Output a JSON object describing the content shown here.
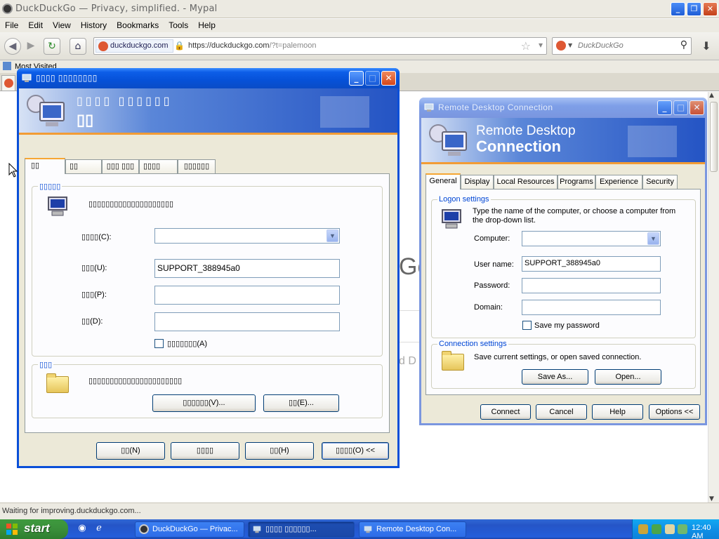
{
  "browser": {
    "title": "DuckDuckGo — Privacy, simplified. - Mypal",
    "menu": [
      "File",
      "Edit",
      "View",
      "History",
      "Bookmarks",
      "Tools",
      "Help"
    ],
    "identity": "duckduckgo.com",
    "url_main": "https://duckduckgo.com",
    "url_tail": "/?t=palemoon",
    "search_placeholder": "DuckDuckGo",
    "bookmark": "Most Visited",
    "status": "Waiting for improving.duckduckgo.com...",
    "page_fragments": {
      "logo": "Go",
      "sub": "d D"
    }
  },
  "garbled_dialog": {
    "title": "▯▯▯▯ ▯▯▯▯▯▯▯▯",
    "banner_line1": "▯▯▯▯ ▯▯▯▯▯▯",
    "banner_line2": "▯▯",
    "tabs": [
      "▯▯",
      "▯▯",
      "▯▯▯ ▯▯▯",
      "▯▯▯▯",
      "▯▯▯▯▯▯"
    ],
    "group1_label": "▯▯▯▯▯",
    "group1_desc": "▯▯▯▯▯▯▯▯▯▯▯▯▯▯▯▯▯▯▯▯",
    "computer_label": "▯▯▯▯(C):",
    "username_label": "▯▯▯(U):",
    "username_value": "SUPPORT_388945a0",
    "password_label": "▯▯▯(P):",
    "domain_label": "▯▯(D):",
    "save_password": "▯▯▯▯▯▯▯(A)",
    "group2_label": "▯▯▯",
    "group2_desc": "▯▯▯▯▯▯▯▯▯▯▯▯▯▯▯▯▯▯▯▯▯▯",
    "save_as": "▯▯▯▯▯▯(V)...",
    "open": "▯▯(E)...",
    "connect": "▯▯(N)",
    "cancel": "▯▯▯▯",
    "help": "▯▯(H)",
    "options": "▯▯▯▯(O) <<"
  },
  "rdc_dialog": {
    "title": "Remote Desktop Connection",
    "banner_line1": "Remote Desktop",
    "banner_line2": "Connection",
    "tabs": [
      "General",
      "Display",
      "Local Resources",
      "Programs",
      "Experience",
      "Security"
    ],
    "logon_group": "Logon settings",
    "logon_desc": "Type the name of the computer, or choose a computer from the drop-down list.",
    "computer_label": "Computer:",
    "computer_value": "",
    "username_label": "User name:",
    "username_value": "SUPPORT_388945a0",
    "password_label": "Password:",
    "domain_label": "Domain:",
    "save_password": "Save my password",
    "connection_group": "Connection settings",
    "connection_desc": "Save current settings, or open saved connection.",
    "save_as": "Save As...",
    "open": "Open...",
    "connect": "Connect",
    "cancel": "Cancel",
    "help": "Help",
    "options": "Options <<"
  },
  "taskbar": {
    "start": "start",
    "tasks": [
      "DuckDuckGo — Privac...",
      "▯▯▯▯ ▯▯▯▯▯▯...",
      "Remote Desktop Con..."
    ],
    "clock": "12:40 AM"
  }
}
